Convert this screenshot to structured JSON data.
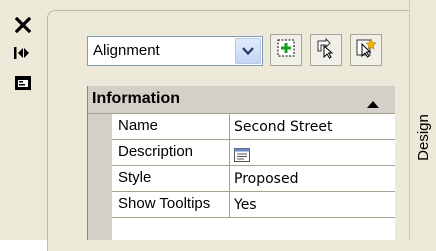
{
  "left_strip": {
    "icons": [
      "close-icon",
      "auto-hide-icon",
      "properties-icon"
    ]
  },
  "toolbar": {
    "object_type": "Alignment",
    "buttons": [
      "toggle-pickadd-icon",
      "select-objects-icon",
      "quick-select-icon"
    ]
  },
  "grid": {
    "category_label": "Information",
    "rows": [
      {
        "name": "Name",
        "value": "Second Street"
      },
      {
        "name": "Description",
        "value": "",
        "value_icon": "text-editor-icon"
      },
      {
        "name": "Style",
        "value": "Proposed"
      },
      {
        "name": "Show Tooltips",
        "value": "Yes"
      }
    ]
  },
  "tabs": {
    "design": "Design"
  },
  "colors": {
    "panel_bg": "#ece9d8",
    "header_bg": "#d4d0c8",
    "select_border": "#7f9db9"
  }
}
